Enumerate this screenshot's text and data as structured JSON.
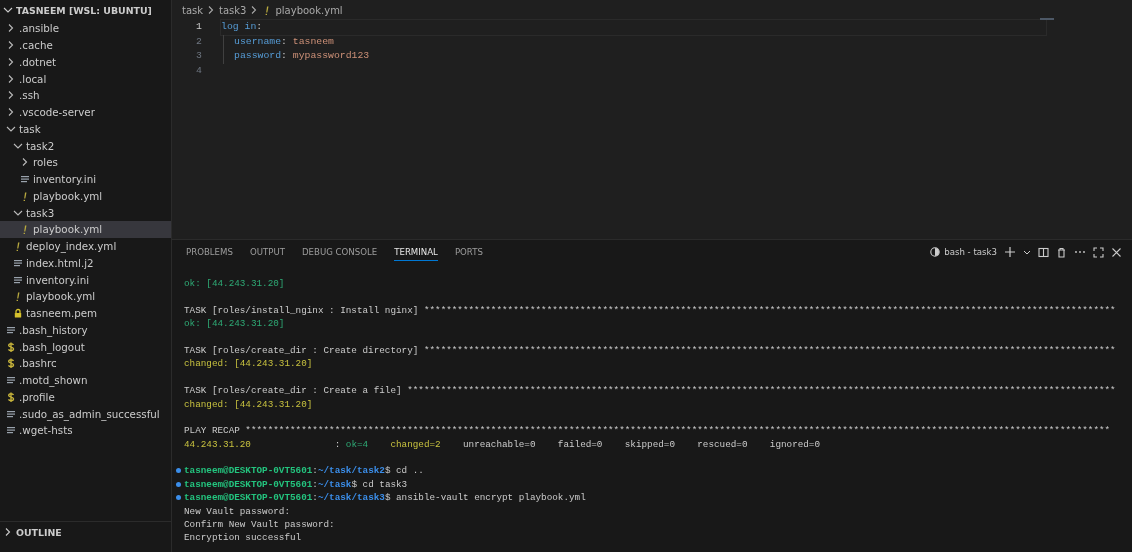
{
  "explorer": {
    "title": "TASNEEM [WSL: UBUNTU]",
    "expanded": true,
    "items": [
      {
        "name": ".ansible",
        "kind": "folder",
        "expanded": false,
        "selected": false
      },
      {
        "name": ".cache",
        "kind": "folder",
        "expanded": false,
        "selected": false
      },
      {
        "name": ".dotnet",
        "kind": "folder",
        "expanded": false,
        "selected": false
      },
      {
        "name": ".local",
        "kind": "folder",
        "expanded": false,
        "selected": false
      },
      {
        "name": ".ssh",
        "kind": "folder",
        "expanded": false,
        "selected": false
      },
      {
        "name": ".vscode-server",
        "kind": "folder",
        "expanded": false,
        "selected": false
      },
      {
        "name": "task",
        "kind": "folder",
        "expanded": true,
        "selected": false,
        "children": [
          {
            "name": "task2",
            "kind": "folder",
            "expanded": true,
            "selected": false,
            "children": [
              {
                "name": "roles",
                "kind": "folder",
                "expanded": false,
                "selected": false
              },
              {
                "name": "inventory.ini",
                "kind": "text",
                "selected": false
              },
              {
                "name": "playbook.yml",
                "kind": "yaml",
                "selected": false
              }
            ]
          },
          {
            "name": "task3",
            "kind": "folder",
            "expanded": true,
            "selected": false,
            "children": [
              {
                "name": "playbook.yml",
                "kind": "yaml",
                "selected": true
              }
            ]
          },
          {
            "name": "deploy_index.yml",
            "kind": "yaml",
            "selected": false
          },
          {
            "name": "index.html.j2",
            "kind": "text",
            "selected": false
          },
          {
            "name": "inventory.ini",
            "kind": "text",
            "selected": false
          },
          {
            "name": "playbook.yml",
            "kind": "yaml",
            "selected": false
          },
          {
            "name": "tasneem.pem",
            "kind": "key",
            "selected": false
          }
        ]
      },
      {
        "name": ".bash_history",
        "kind": "text",
        "selected": false
      },
      {
        "name": ".bash_logout",
        "kind": "shell",
        "selected": false
      },
      {
        "name": ".bashrc",
        "kind": "shell",
        "selected": false
      },
      {
        "name": ".motd_shown",
        "kind": "text",
        "selected": false
      },
      {
        "name": ".profile",
        "kind": "shell",
        "selected": false
      },
      {
        "name": ".sudo_as_admin_successful",
        "kind": "text",
        "selected": false
      },
      {
        "name": ".wget-hsts",
        "kind": "text",
        "selected": false
      }
    ]
  },
  "outline": {
    "title": "OUTLINE",
    "expanded": false
  },
  "editor": {
    "breadcrumbs": [
      "task",
      "task3",
      "playbook.yml"
    ],
    "lines": [
      {
        "number": "1",
        "current": true,
        "segments": [
          {
            "text": "log in",
            "kind": "key"
          },
          {
            "text": ":",
            "kind": "punct"
          }
        ],
        "children": [
          {
            "number": "2",
            "current": false,
            "segments": [
              {
                "text": "username",
                "kind": "key"
              },
              {
                "text": ": ",
                "kind": "punct"
              },
              {
                "text": "tasneem",
                "kind": "value"
              }
            ]
          },
          {
            "number": "3",
            "current": false,
            "segments": [
              {
                "text": "password",
                "kind": "key"
              },
              {
                "text": ": ",
                "kind": "punct"
              },
              {
                "text": "mypassword123",
                "kind": "value"
              }
            ]
          }
        ]
      },
      {
        "number": "4",
        "current": false
      }
    ]
  },
  "panel": {
    "tabs": [
      {
        "label": "PROBLEMS",
        "selected": false
      },
      {
        "label": "OUTPUT",
        "selected": false
      },
      {
        "label": "DEBUG CONSOLE",
        "selected": false
      },
      {
        "label": "TERMINAL",
        "selected": true
      },
      {
        "label": "PORTS",
        "selected": false
      }
    ],
    "terminal_name": "bash - task3",
    "lines": [
      {
        "kind": "output",
        "segments": [
          {
            "text": "ok: [44.243.31.20]",
            "kind": "ok"
          }
        ]
      },
      {
        "kind": "blank"
      },
      {
        "kind": "output",
        "segments": [
          {
            "text": "TASK [roles/install_nginx : Install nginx] ****************************************************************************************************************************",
            "kind": "plain"
          }
        ]
      },
      {
        "kind": "output",
        "segments": [
          {
            "text": "ok: [44.243.31.20]",
            "kind": "ok"
          }
        ]
      },
      {
        "kind": "blank"
      },
      {
        "kind": "output",
        "segments": [
          {
            "text": "TASK [roles/create_dir : Create directory] ****************************************************************************************************************************",
            "kind": "plain"
          }
        ]
      },
      {
        "kind": "output",
        "segments": [
          {
            "text": "changed: [44.243.31.20]",
            "kind": "changed"
          }
        ]
      },
      {
        "kind": "blank"
      },
      {
        "kind": "output",
        "segments": [
          {
            "text": "TASK [roles/create_dir : Create a file] *******************************************************************************************************************************",
            "kind": "plain"
          }
        ]
      },
      {
        "kind": "output",
        "segments": [
          {
            "text": "changed: [44.243.31.20]",
            "kind": "changed"
          }
        ]
      },
      {
        "kind": "blank"
      },
      {
        "kind": "output",
        "segments": [
          {
            "text": "PLAY RECAP ***********************************************************************************************************************************************************",
            "kind": "plain"
          }
        ]
      },
      {
        "kind": "output",
        "segments": [
          {
            "text": "44.243.31.20",
            "kind": "changed"
          },
          {
            "text": "               : ",
            "kind": "plain"
          },
          {
            "text": "ok=4",
            "kind": "ok"
          },
          {
            "text": "    changed=2",
            "kind": "changed"
          },
          {
            "text": "    unreachable=0    failed=0    skipped=0    rescued=0    ignored=0",
            "kind": "plain"
          }
        ]
      },
      {
        "kind": "blank"
      },
      {
        "kind": "prompt",
        "segments": [
          {
            "text": "tasneem@DESKTOP-0VT5601",
            "kind": "user"
          },
          {
            "text": ":",
            "kind": "plain"
          },
          {
            "text": "~/task/task2",
            "kind": "path"
          },
          {
            "text": "$ cd ..",
            "kind": "plain"
          }
        ]
      },
      {
        "kind": "prompt",
        "segments": [
          {
            "text": "tasneem@DESKTOP-0VT5601",
            "kind": "user"
          },
          {
            "text": ":",
            "kind": "plain"
          },
          {
            "text": "~/task",
            "kind": "path"
          },
          {
            "text": "$ cd task3",
            "kind": "plain"
          }
        ]
      },
      {
        "kind": "prompt",
        "segments": [
          {
            "text": "tasneem@DESKTOP-0VT5601",
            "kind": "user"
          },
          {
            "text": ":",
            "kind": "plain"
          },
          {
            "text": "~/task/task3",
            "kind": "path"
          },
          {
            "text": "$ ansible-vault encrypt playbook.yml",
            "kind": "plain"
          }
        ]
      },
      {
        "kind": "output",
        "segments": [
          {
            "text": "New Vault password:",
            "kind": "plain"
          }
        ]
      },
      {
        "kind": "output",
        "segments": [
          {
            "text": "Confirm New Vault password:",
            "kind": "plain"
          }
        ]
      },
      {
        "kind": "output",
        "segments": [
          {
            "text": "Encryption successful",
            "kind": "plain"
          }
        ]
      }
    ]
  }
}
